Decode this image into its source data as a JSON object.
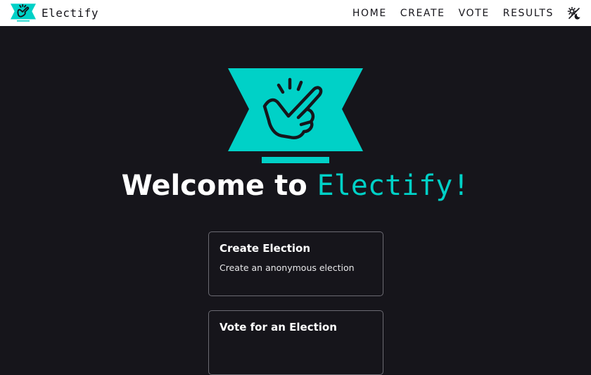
{
  "app": {
    "name": "Electify",
    "accent_color": "#00d1c7",
    "background_color": "#16151b"
  },
  "navbar": {
    "brand_label": "Electify",
    "links": [
      {
        "label": "HOME"
      },
      {
        "label": "CREATE"
      },
      {
        "label": "VOTE"
      },
      {
        "label": "RESULTS"
      }
    ],
    "theme_toggle_icon": "theme-toggle-icon"
  },
  "hero": {
    "logo_icon": "snap-fingers-ballot-icon",
    "title_prefix": "Welcome to",
    "title_brand": "Electify!"
  },
  "cards": [
    {
      "title": "Create Election",
      "description": "Create an anonymous election"
    },
    {
      "title": "Vote for an Election",
      "description": ""
    }
  ]
}
